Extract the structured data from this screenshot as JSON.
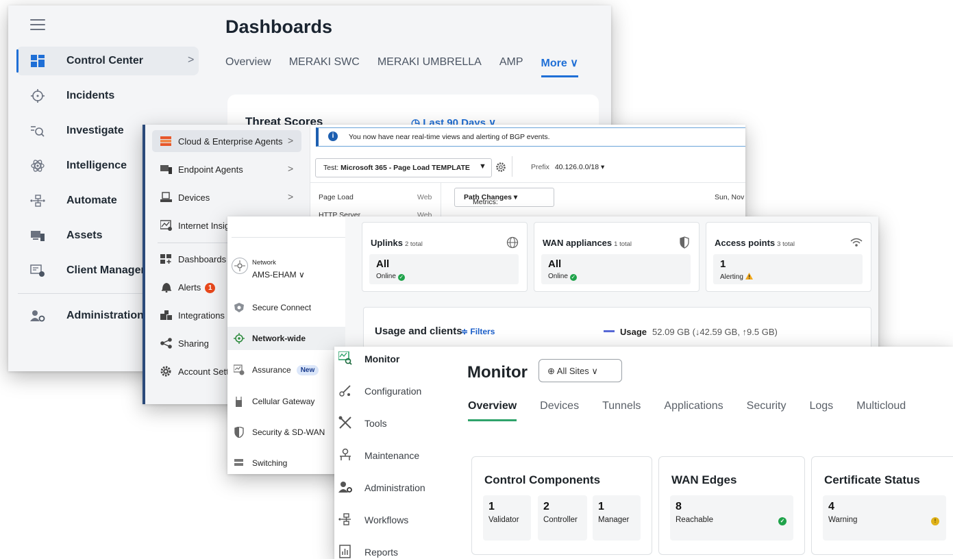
{
  "xdr": {
    "page_title": "Dashboards",
    "nav": [
      {
        "label": "Control Center",
        "icon": "grid-icon",
        "active": true
      },
      {
        "label": "Incidents",
        "icon": "crosshair-icon"
      },
      {
        "label": "Investigate",
        "icon": "search-list-icon"
      },
      {
        "label": "Intelligence",
        "icon": "atom-icon"
      },
      {
        "label": "Automate",
        "icon": "workflow-icon"
      },
      {
        "label": "Assets",
        "icon": "devices-icon"
      },
      {
        "label": "Client Manageme",
        "icon": "client-icon"
      },
      {
        "label": "Administration",
        "icon": "admin-user-icon"
      }
    ],
    "chevron": ">",
    "tabs": [
      "Overview",
      "MERAKI SWC",
      "MERAKI UMBRELLA",
      "AMP",
      "More ∨"
    ],
    "card": {
      "title": "Threat Scores",
      "range": "◷ Last 90 Days ∨"
    }
  },
  "thousandeyes": {
    "nav": [
      {
        "label": "Cloud & Enterprise Agents",
        "icon": "cloud-agents-icon",
        "chevron": ">",
        "active": true
      },
      {
        "label": "Endpoint Agents",
        "icon": "endpoint-icon",
        "chevron": ">"
      },
      {
        "label": "Devices",
        "icon": "devices-icon",
        "chevron": ">"
      },
      {
        "label": "Internet Insig",
        "icon": "internet-insights-icon"
      },
      {
        "label": "Dashboards",
        "icon": "dashboards-icon"
      },
      {
        "label": "Alerts",
        "icon": "bell-icon",
        "badge": "1"
      },
      {
        "label": "Integrations",
        "icon": "integrations-icon"
      },
      {
        "label": "Sharing",
        "icon": "share-icon"
      },
      {
        "label": "Account Sett",
        "icon": "gear-icon"
      }
    ],
    "notice": "You now have near real-time views and alerting of BGP events.",
    "test_label": "Test:",
    "test_value": "Microsoft 365 - Page Load TEMPLATE",
    "prefix_label": "Prefix",
    "prefix_value": "40.126.0.0/18 ▾",
    "rows": [
      {
        "name": "Page Load",
        "type": "Web"
      },
      {
        "name": "HTTP Server",
        "type": "Web"
      }
    ],
    "metrics_label": "Metrics:",
    "metrics_value": "Path Changes ▾",
    "date": "Sun, Nov"
  },
  "meraki": {
    "network_label": "Network",
    "network_value": "AMS-EHAM ∨",
    "nav": [
      {
        "label": "Secure Connect",
        "icon": "secure-connect-icon"
      },
      {
        "label": "Network-wide",
        "icon": "network-wide-icon",
        "active": true
      },
      {
        "label": "Assurance",
        "icon": "assurance-icon",
        "badge": "New"
      },
      {
        "label": "Cellular Gateway",
        "icon": "cellular-gateway-icon"
      },
      {
        "label": "Security & SD-WAN",
        "icon": "shield-icon"
      },
      {
        "label": "Switching",
        "icon": "switch-icon"
      }
    ],
    "cards": [
      {
        "title": "Uplinks",
        "sub": "2 total",
        "value": "All",
        "status": "Online",
        "icon": "globe-icon",
        "status_type": "ok"
      },
      {
        "title": "WAN appliances",
        "sub": "1 total",
        "value": "All",
        "status": "Online",
        "icon": "shield-half-icon",
        "status_type": "ok"
      },
      {
        "title": "Access points",
        "sub": "3 total",
        "value": "1",
        "status": "Alerting",
        "icon": "wifi-icon",
        "status_type": "warn"
      }
    ],
    "usage": {
      "title": "Usage and clients",
      "filters": "≑ Filters",
      "legend": "Usage",
      "value": "52.09 GB (↓42.59 GB, ↑9.5 GB)"
    }
  },
  "sdwan": {
    "nav": [
      {
        "label": "Monitor",
        "icon": "monitor-icon",
        "active": true
      },
      {
        "label": "Configuration",
        "icon": "configuration-icon"
      },
      {
        "label": "Tools",
        "icon": "tools-icon"
      },
      {
        "label": "Maintenance",
        "icon": "maintenance-icon"
      },
      {
        "label": "Administration",
        "icon": "administration-icon"
      },
      {
        "label": "Workflows",
        "icon": "workflows-icon"
      },
      {
        "label": "Reports",
        "icon": "reports-icon"
      }
    ],
    "title": "Monitor",
    "sites": "⊕ All Sites ∨",
    "tabs": [
      "Overview",
      "Devices",
      "Tunnels",
      "Applications",
      "Security",
      "Logs",
      "Multicloud"
    ],
    "cards": [
      {
        "title": "Control Components",
        "items": [
          {
            "value": "1",
            "label": "Validator"
          },
          {
            "value": "2",
            "label": "Controller"
          },
          {
            "value": "1",
            "label": "Manager"
          }
        ]
      },
      {
        "title": "WAN Edges",
        "items": [
          {
            "value": "8",
            "label": "Reachable",
            "status": "ok"
          }
        ]
      },
      {
        "title": "Certificate Status",
        "items": [
          {
            "value": "4",
            "label": "Warning",
            "status": "warn"
          }
        ]
      }
    ],
    "colors": {
      "ok": "#1fa34a",
      "warn": "#e0b21a",
      "accent": "#2fa36b"
    }
  }
}
